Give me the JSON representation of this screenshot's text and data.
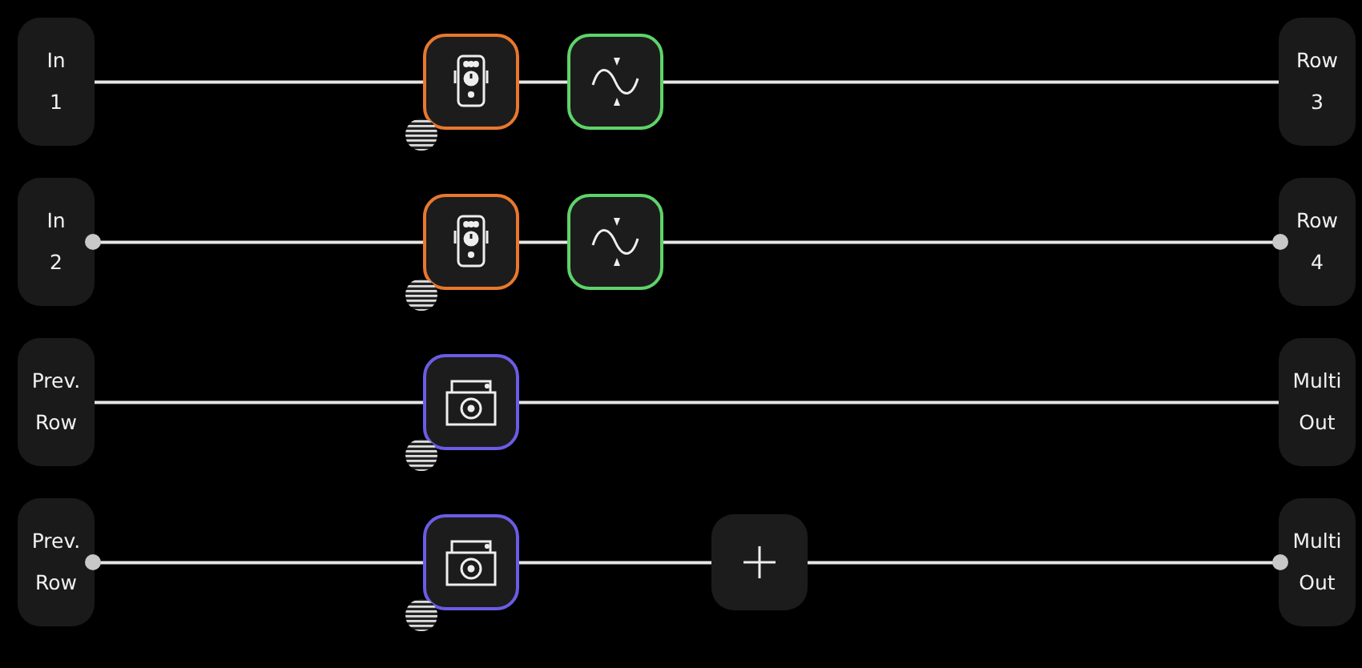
{
  "rows": [
    {
      "input": [
        "In",
        "1"
      ],
      "output": [
        "Row",
        "3"
      ],
      "linked": false,
      "blocks": [
        {
          "kind": "pedal",
          "color": "#e8782e"
        },
        {
          "kind": "wave",
          "color": "#5ed36a"
        }
      ]
    },
    {
      "input": [
        "In",
        "2"
      ],
      "output": [
        "Row",
        "4"
      ],
      "linked": true,
      "blocks": [
        {
          "kind": "pedal",
          "color": "#e8782e"
        },
        {
          "kind": "wave",
          "color": "#5ed36a"
        }
      ]
    },
    {
      "input": [
        "Prev.",
        "Row"
      ],
      "output": [
        "Multi",
        "Out"
      ],
      "linked": false,
      "blocks": [
        {
          "kind": "looper",
          "color": "#6b5ce6"
        }
      ]
    },
    {
      "input": [
        "Prev.",
        "Row"
      ],
      "output": [
        "Multi",
        "Out"
      ],
      "linked": true,
      "blocks": [
        {
          "kind": "looper",
          "color": "#6b5ce6"
        },
        {
          "kind": "add"
        }
      ]
    }
  ]
}
